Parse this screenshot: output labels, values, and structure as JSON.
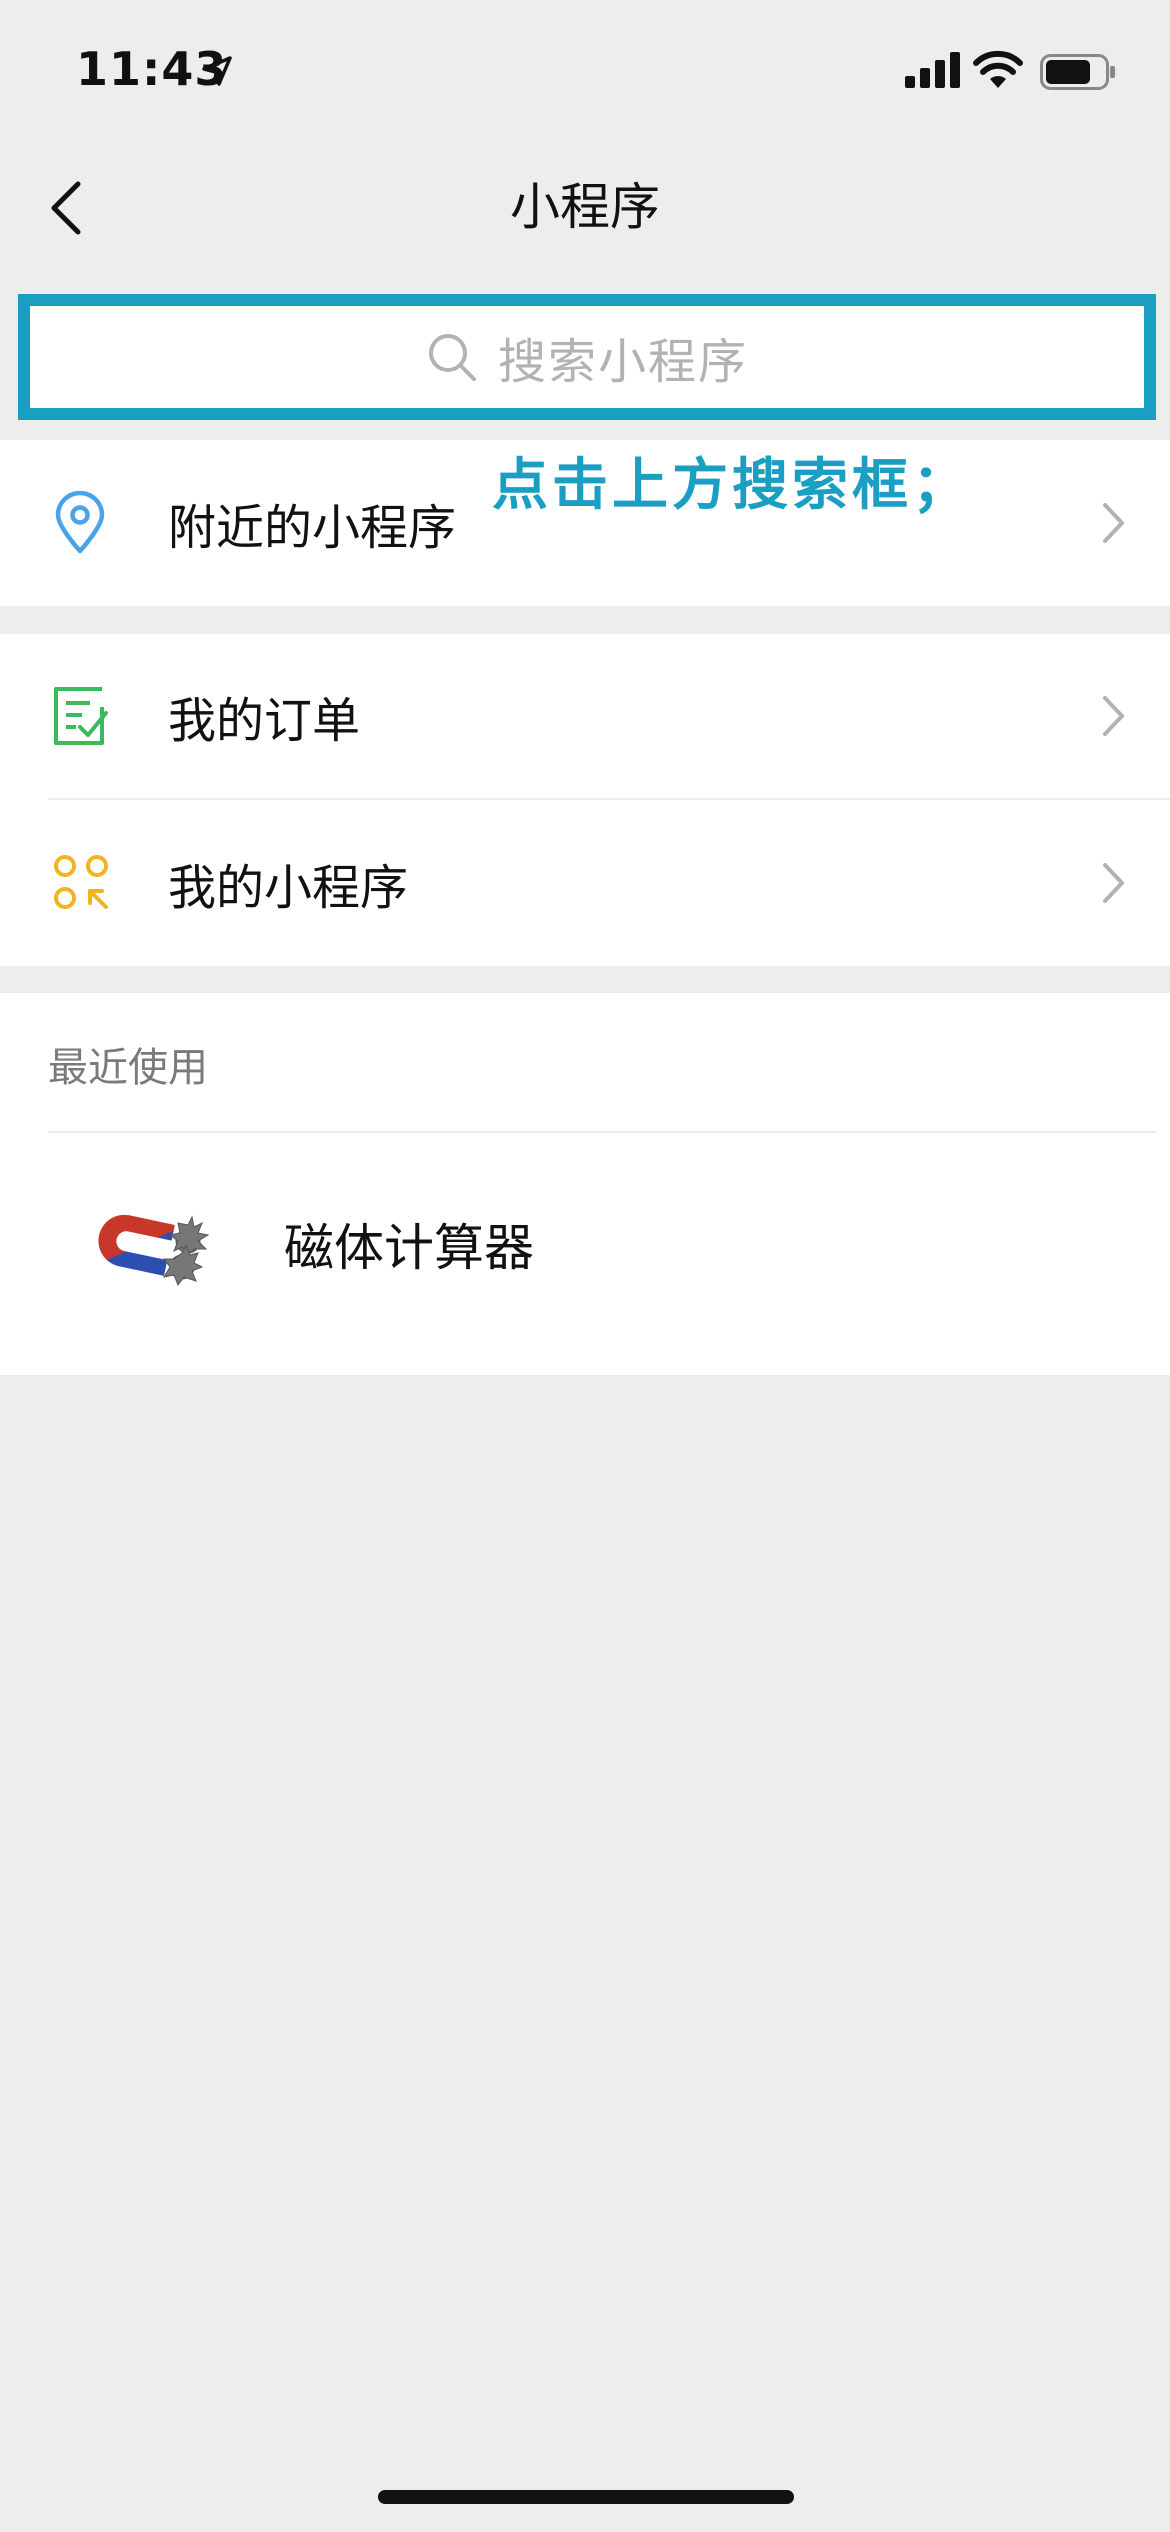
{
  "status_bar": {
    "time": "11:43"
  },
  "nav": {
    "title": "小程序"
  },
  "search": {
    "placeholder": "搜索小程序"
  },
  "annotation": {
    "text": "点击上方搜索框；"
  },
  "menu": {
    "nearby": "附近的小程序",
    "orders": "我的订单",
    "my_mini_programs": "我的小程序"
  },
  "recent": {
    "section_title": "最近使用",
    "items": [
      {
        "name": "磁体计算器",
        "icon": "magnet-icon"
      }
    ]
  },
  "colors": {
    "highlight": "#1a9ec2",
    "location_icon": "#4aa3e8",
    "order_icon": "#3cb95a",
    "mini_program_icon": "#f2b320"
  }
}
